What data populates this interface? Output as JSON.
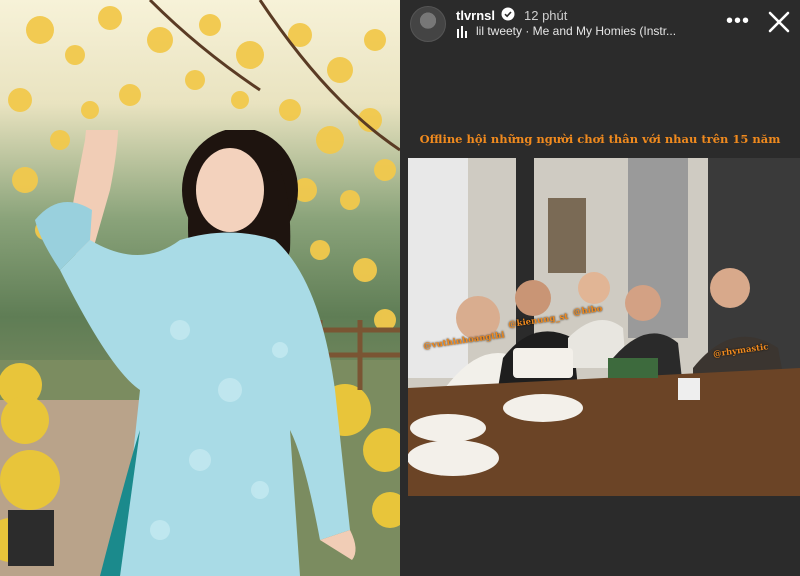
{
  "story": {
    "username": "tlvrnsl",
    "time_ago": "12 phút",
    "music": "lil tweety · Me and My Homies (Instr...",
    "caption": "Offline hội những người chơi thân với nhau trên 15 năm",
    "tags": [
      "@vuthinhoangthi",
      "@kienung_st",
      "@hibo",
      "@rhymastic"
    ]
  },
  "icons": {
    "verified": "verified-badge-icon",
    "music": "music-bars-icon",
    "more": "more-dots-icon",
    "close": "close-icon"
  },
  "colors": {
    "caption": "#f08a1e",
    "verified": "#ffffff"
  }
}
